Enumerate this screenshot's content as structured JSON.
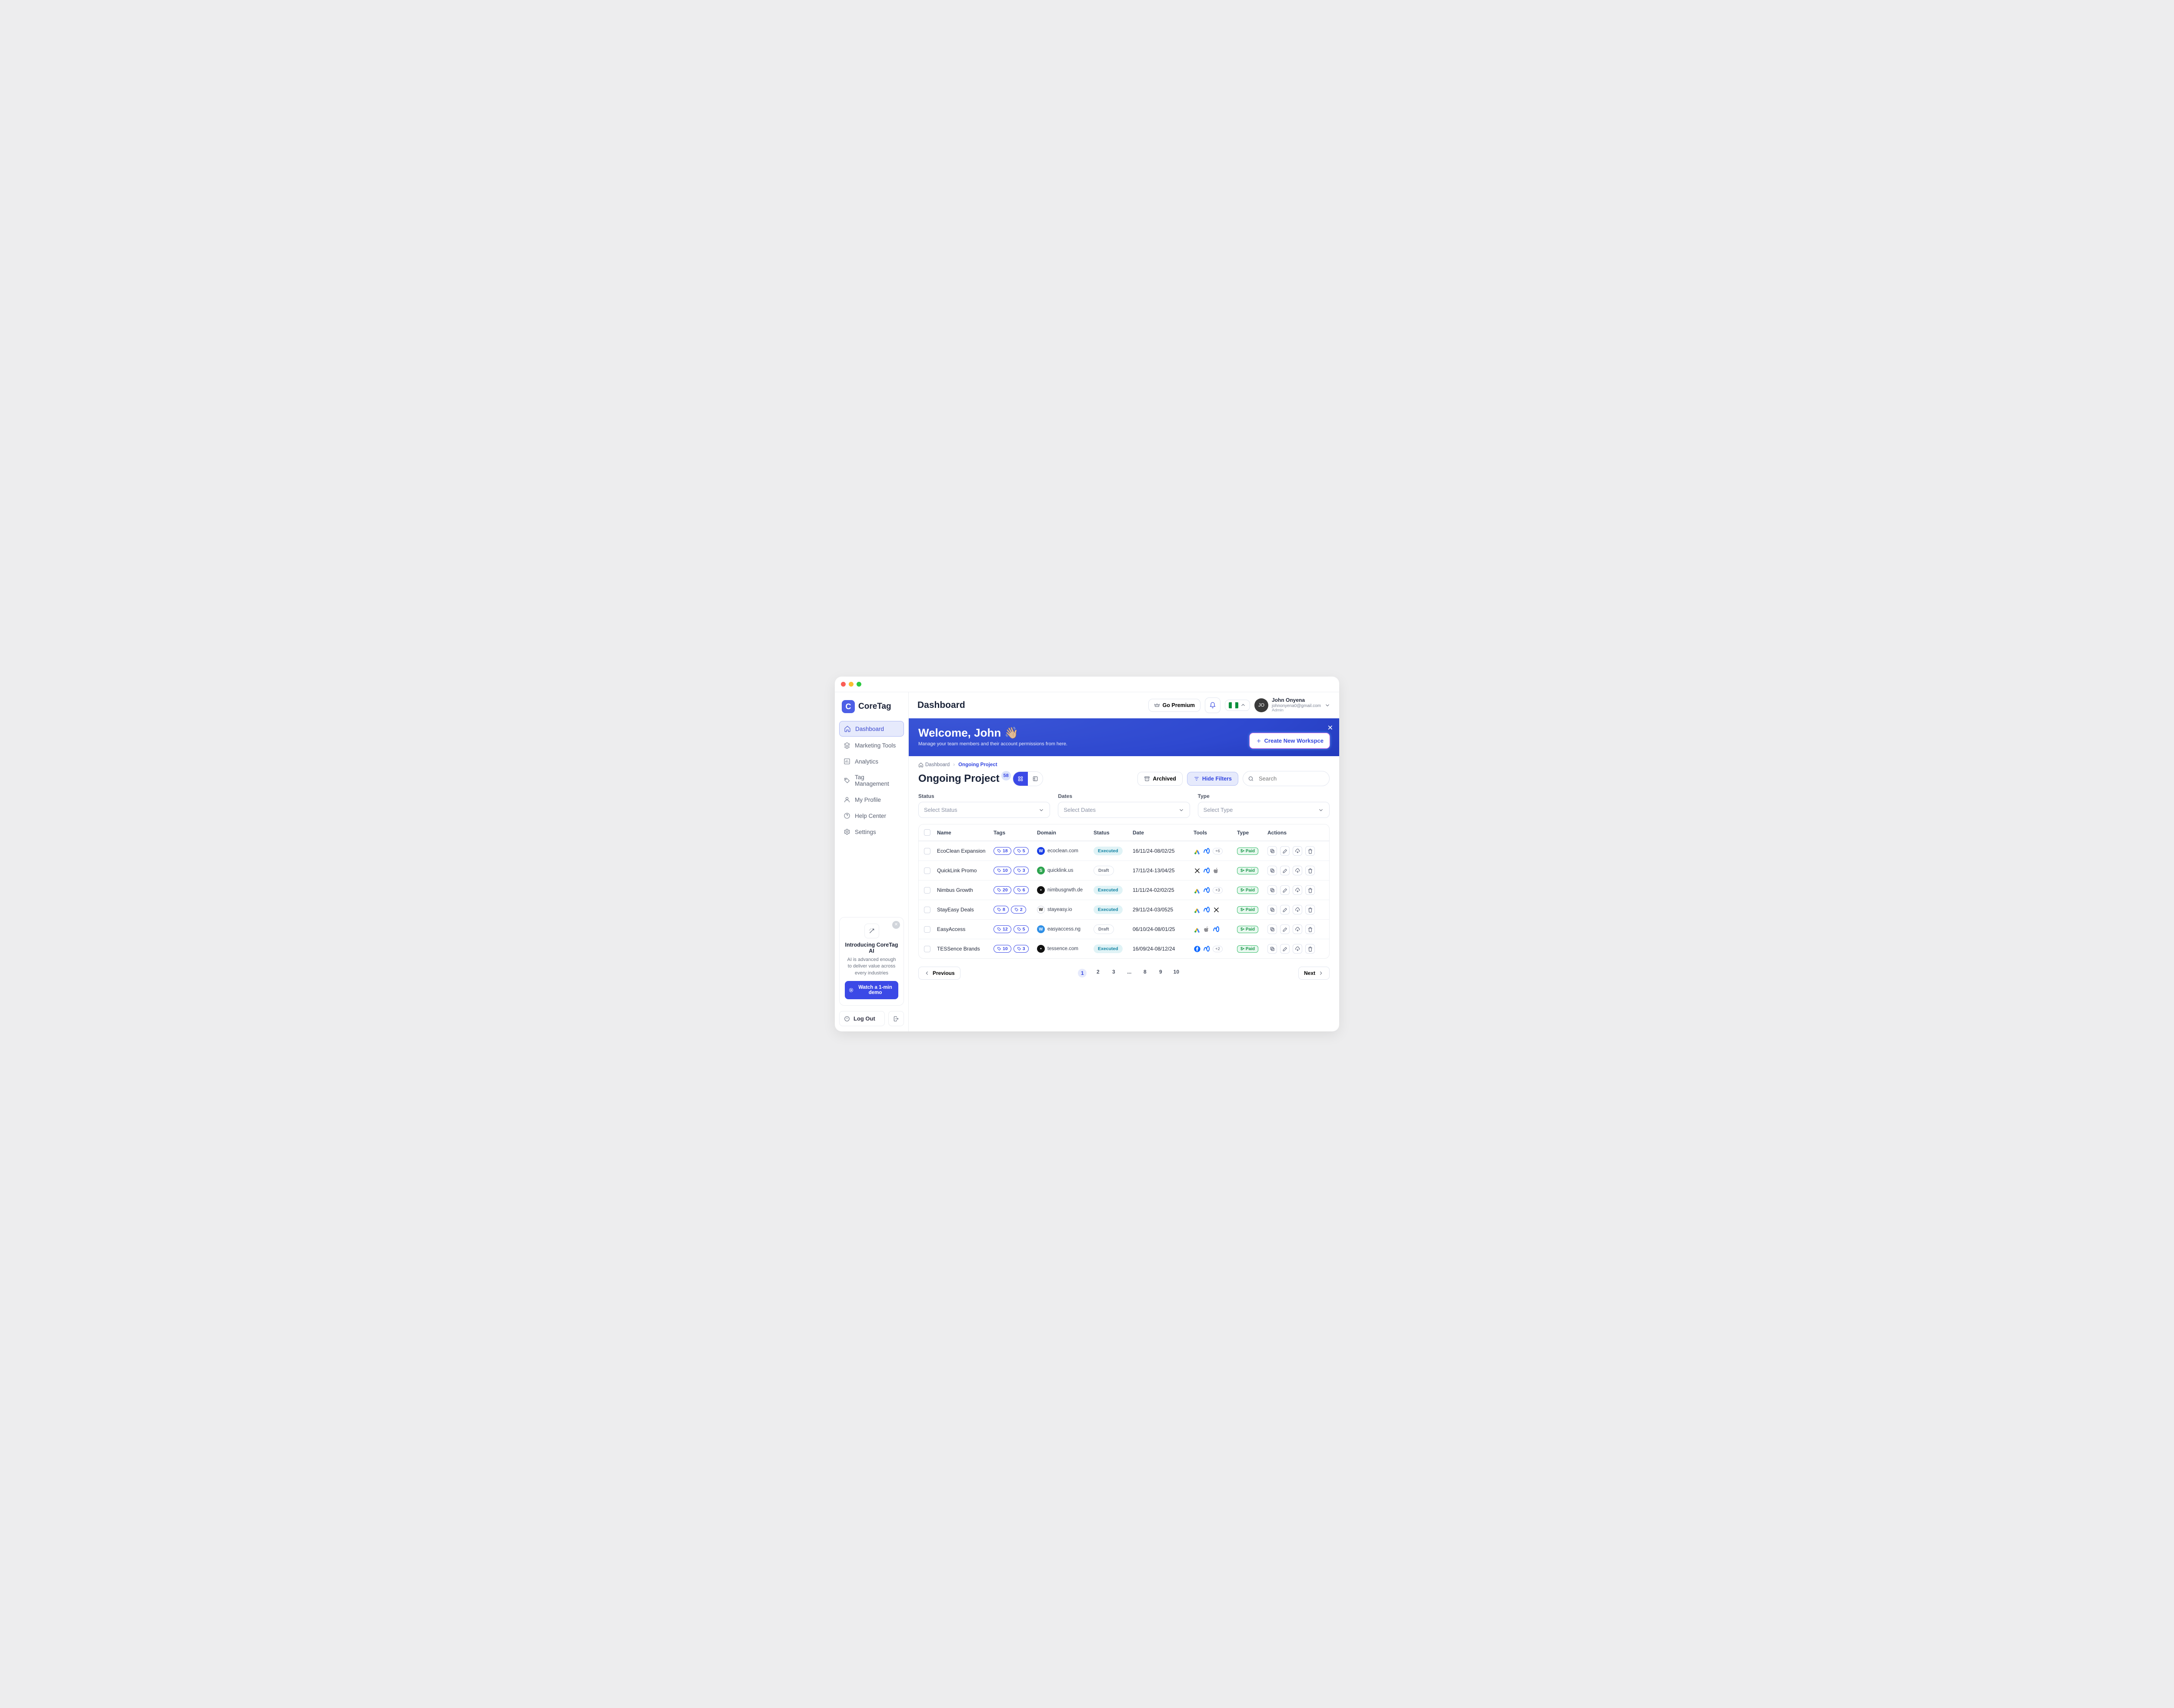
{
  "brand": {
    "logo_letter": "C",
    "name": "CoreTag"
  },
  "sidebar": {
    "items": [
      {
        "label": "Dashboard",
        "icon": "home-icon",
        "active": true
      },
      {
        "label": "Marketing Tools",
        "icon": "layers-icon"
      },
      {
        "label": "Analytics",
        "icon": "chart-icon"
      },
      {
        "label": "Tag Management",
        "icon": "tag-icon"
      },
      {
        "label": "My Profile",
        "icon": "user-icon"
      },
      {
        "label": "Help Center",
        "icon": "help-icon"
      },
      {
        "label": "Settings",
        "icon": "gear-icon"
      }
    ],
    "ai": {
      "title": "Introducing CoreTag AI",
      "text": "AI is advanced enough to deliver value across every industries",
      "cta": "Watch a 1-min demo"
    },
    "logout_label": "Log Out"
  },
  "topbar": {
    "title": "Dashboard",
    "premium_label": "Go Premium",
    "user": {
      "name": "John Onyena",
      "email": "johnonyena0@gmail.com",
      "role": "Admin"
    }
  },
  "hero": {
    "heading": "Welcome, John",
    "wave": "👋🏼",
    "sub": "Manage your team members and their account permissions from here.",
    "cta": "Create New Workspce"
  },
  "crumbs": {
    "root": "Dashboard",
    "current": "Ongoing Project"
  },
  "section": {
    "title": "Ongoing Project",
    "count": "58",
    "archived_label": "Archived",
    "filters_label": "Hide Filters",
    "search_placeholder": "Search"
  },
  "filters": {
    "status": {
      "label": "Status",
      "placeholder": "Select Status"
    },
    "dates": {
      "label": "Dates",
      "placeholder": "Select Dates"
    },
    "type": {
      "label": "Type",
      "placeholder": "Select Type"
    }
  },
  "table": {
    "headers": {
      "name": "Name",
      "tags": "Tags",
      "domain": "Domain",
      "status": "Status",
      "date": "Date",
      "tools": "Tools",
      "type": "Type",
      "actions": "Actions"
    },
    "rows": [
      {
        "name": "EcoClean Expansion",
        "tag_a": "18",
        "tag_b": "5",
        "fav": "W",
        "fav_bg": "#1a3fe6",
        "domain": "ecoclean.com",
        "status": "Executed",
        "date": "16/11/24-08/02/25",
        "tools": [
          "gads",
          "meta"
        ],
        "more": "+6",
        "type": "$• Paid"
      },
      {
        "name": "QuickLink Promo",
        "tag_a": "10",
        "tag_b": "3",
        "fav": "S",
        "fav_bg": "#2ea44f",
        "domain": "quicklink.us",
        "status": "Draft",
        "date": "17/11/24-13/04/25",
        "tools": [
          "x",
          "meta",
          "apple"
        ],
        "more": "",
        "type": "$• Paid"
      },
      {
        "name": "Nimbus Growth",
        "tag_a": "20",
        "tag_b": "6",
        "fav": "•",
        "fav_bg": "#111",
        "domain": "nimbusgrwth.de",
        "status": "Executed",
        "date": "11/11/24-02/02/25",
        "tools": [
          "gads",
          "meta"
        ],
        "more": "+3",
        "type": "$• Paid"
      },
      {
        "name": "StayEasy Deals",
        "tag_a": "8",
        "tag_b": "2",
        "fav": "W",
        "fav_bg": "#fff",
        "fav_fg": "#111",
        "favBorder": true,
        "domain": "stayeasy.io",
        "status": "Executed",
        "date": "29/11/24-03/0525",
        "tools": [
          "gads",
          "meta",
          "x"
        ],
        "more": "",
        "type": "$• Paid"
      },
      {
        "name": "EasyAccess",
        "tag_a": "12",
        "tag_b": "5",
        "fav": "W",
        "fav_bg": "#2e8fe6",
        "domain": "easyaccess.ng",
        "status": "Draft",
        "date": "06/10/24-08/01/25",
        "tools": [
          "gads",
          "apple",
          "meta"
        ],
        "more": "",
        "type": "$• Paid"
      },
      {
        "name": "TESSence Brands",
        "tag_a": "10",
        "tag_b": "3",
        "fav": "•",
        "fav_bg": "#111",
        "domain": "tessence.com",
        "status": "Executed",
        "date": "16/09/24-08/12/24",
        "tools": [
          "facebook",
          "meta"
        ],
        "more": "+2",
        "type": "$• Paid"
      }
    ]
  },
  "pager": {
    "prev": "Previous",
    "next": "Next",
    "pages": [
      "1",
      "2",
      "3",
      "...",
      "8",
      "9",
      "10"
    ]
  }
}
